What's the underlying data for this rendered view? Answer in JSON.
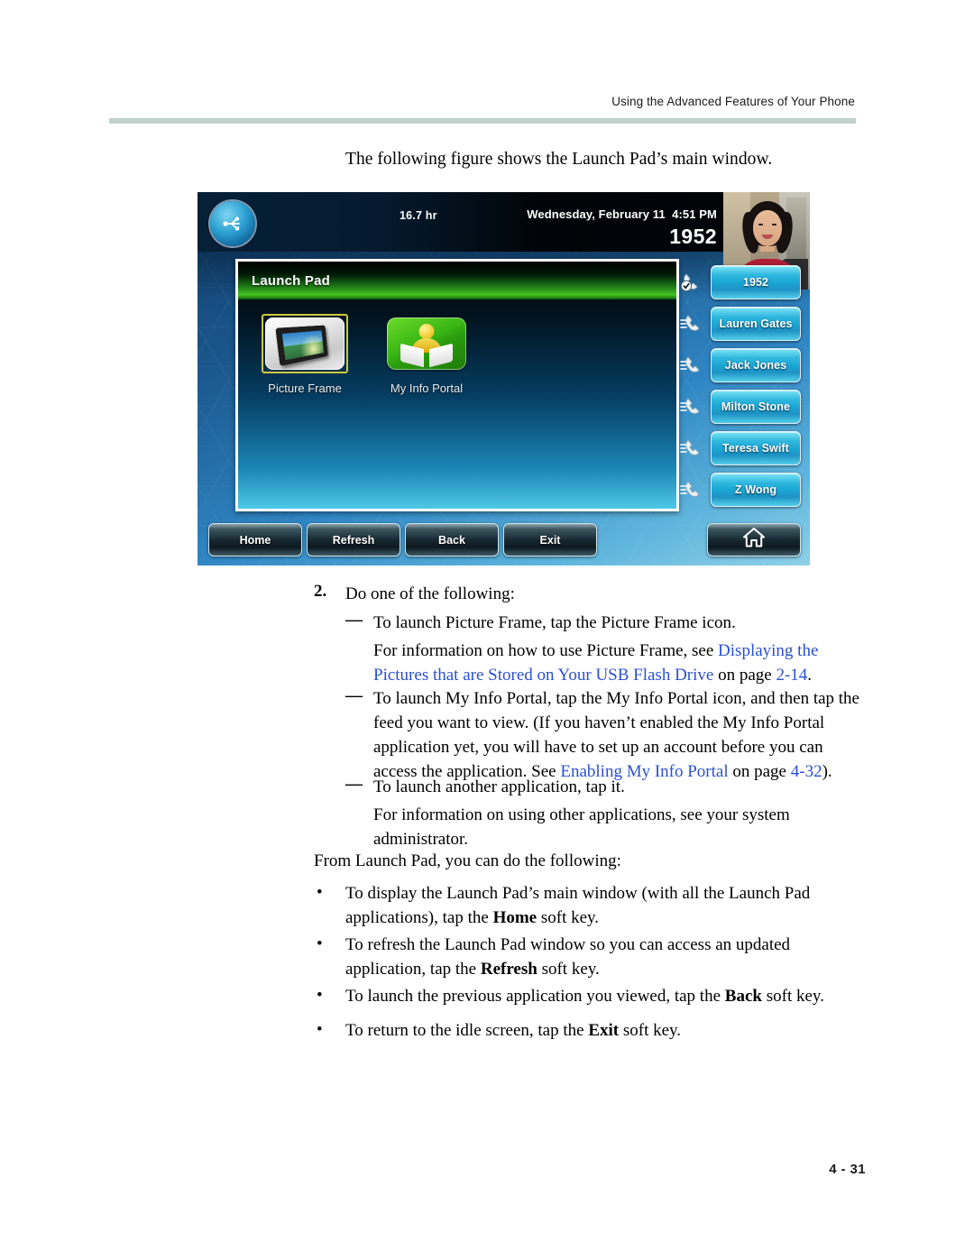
{
  "header": {
    "running_head": "Using the Advanced Features of Your Phone"
  },
  "intro": {
    "line": "The following figure shows the Launch Pad’s main window."
  },
  "figure": {
    "statusbar": {
      "uptime": "16.7 hr",
      "datetime": "Wednesday, February 11  4:51 PM",
      "extension": "1952",
      "usb_icon": "usb-icon"
    },
    "window": {
      "title": "Launch Pad"
    },
    "apps": [
      {
        "label": "Picture Frame",
        "icon": "picture-frame-icon",
        "selected": true
      },
      {
        "label": "My Info Portal",
        "icon": "my-info-portal-icon",
        "selected": false
      }
    ],
    "line_keys": [
      {
        "label": "1952",
        "icon": "handset-registered-icon"
      },
      {
        "label": "Lauren Gates",
        "icon": "handset-icon"
      },
      {
        "label": "Jack Jones",
        "icon": "handset-icon"
      },
      {
        "label": "Milton Stone",
        "icon": "handset-icon"
      },
      {
        "label": "Teresa Swift",
        "icon": "handset-icon"
      },
      {
        "label": "Z Wong",
        "icon": "handset-icon"
      }
    ],
    "soft_keys": [
      {
        "label": "Home"
      },
      {
        "label": "Refresh"
      },
      {
        "label": "Back"
      },
      {
        "label": "Exit"
      }
    ],
    "home_key": {
      "icon": "home-icon"
    }
  },
  "body": {
    "step2_num": "2.",
    "step2_text": "Do one of the following:",
    "dash": "—",
    "bullet1_line1": "To launch Picture Frame, tap the Picture Frame icon.",
    "para1_a": "For information on how to use Picture Frame, see ",
    "para1_link1": "Displaying the",
    "para1_link2": "Pictures that are Stored on Your USB Flash Drive",
    "para1_b": " on page ",
    "para1_link3": "2-14",
    "para1_c": ".",
    "bullet2_l1": "To launch My Info Portal, tap the My Info Portal icon, and then tap the",
    "bullet2_l2": "feed you want to view. (If you haven’t enabled the My Info Portal",
    "bullet2_l3": "application yet, you will have to set up an account before you can",
    "bullet2_l4_a": "access the application. See ",
    "bullet2_l4_link": "Enabling My Info Portal",
    "bullet2_l4_b": " on page ",
    "bullet2_l4_link2": "4-32",
    "bullet2_l4_c": ").",
    "bullet3": "To launch another application, tap it.",
    "para3_l1": "For information on using other applications, see your system",
    "para3_l2": "administrator.",
    "from_line": "From Launch Pad, you can do the following:",
    "bullet_char": "•",
    "b1_l1": "To display the Launch Pad’s main window (with all the Launch Pad",
    "b1_l2_a": "applications), tap the ",
    "b1_l2_bold": "Home",
    "b1_l2_b": " soft key.",
    "b2_l1": "To refresh the Launch Pad window so you can access an updated",
    "b2_l2_a": "application, tap the ",
    "b2_l2_bold": "Refresh",
    "b2_l2_b": " soft key.",
    "b3_a": "To launch the previous application you viewed, tap the ",
    "b3_bold": "Back",
    "b3_b": " soft key.",
    "b4_a": "To return to the idle screen, tap the ",
    "b4_bold": "Exit",
    "b4_b": " soft key."
  },
  "footer": {
    "page_number": "4 - 31"
  }
}
